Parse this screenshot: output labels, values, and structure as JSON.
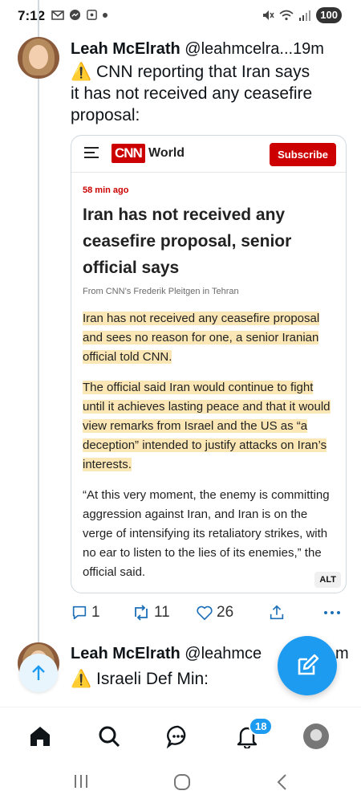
{
  "status_bar": {
    "time": "7:12",
    "battery": "100",
    "left_icons": [
      "gmail-icon",
      "messenger-icon",
      "screenshot-icon",
      "dot-icon"
    ],
    "right_icons": [
      "mute-icon",
      "wifi-icon",
      "signal-icon"
    ]
  },
  "tweet1": {
    "name": "Leah McElrath",
    "handle": "@leahmcelra...",
    "time": "19m",
    "text_line1": "⚠️ CNN reporting that Iran says",
    "text_line2": "it has not received any ceasefire",
    "text_line3": "proposal:",
    "card": {
      "brand_world": "World",
      "brand_logo": "CNN",
      "subscribe": "Subscribe",
      "ago": "58 min ago",
      "headline": "Iran has not received any ceasefire proposal, senior official says",
      "byline": "From CNN’s Frederik Pleitgen in Tehran",
      "para1": "Iran has not received any ceasefire proposal and sees no reason for one, a senior Iranian official told CNN.",
      "para2": "The official said Iran would continue to fight until it achieves lasting peace and that it would view remarks from Israel and the US as “a deception” intended to justify attacks on Iran’s interests.",
      "para3": "“At this very moment, the enemy is committing aggression against Iran, and Iran is on the verge of intensifying its retaliatory strikes, with no ear to listen to the lies of its enemies,” the official said.",
      "alt": "ALT"
    },
    "actions": {
      "replies": "1",
      "retweets": "11",
      "likes": "26"
    }
  },
  "tweet2": {
    "name": "Leah McElrath",
    "handle": "@leahmce",
    "time_fragment": "m",
    "text": "⚠️ Israeli Def Min:"
  },
  "bottom_nav": {
    "notifications_count": "18"
  },
  "colors": {
    "accent": "#1d9bf0",
    "cnn_red": "#cc0000",
    "highlight": "#fbe7b5"
  }
}
